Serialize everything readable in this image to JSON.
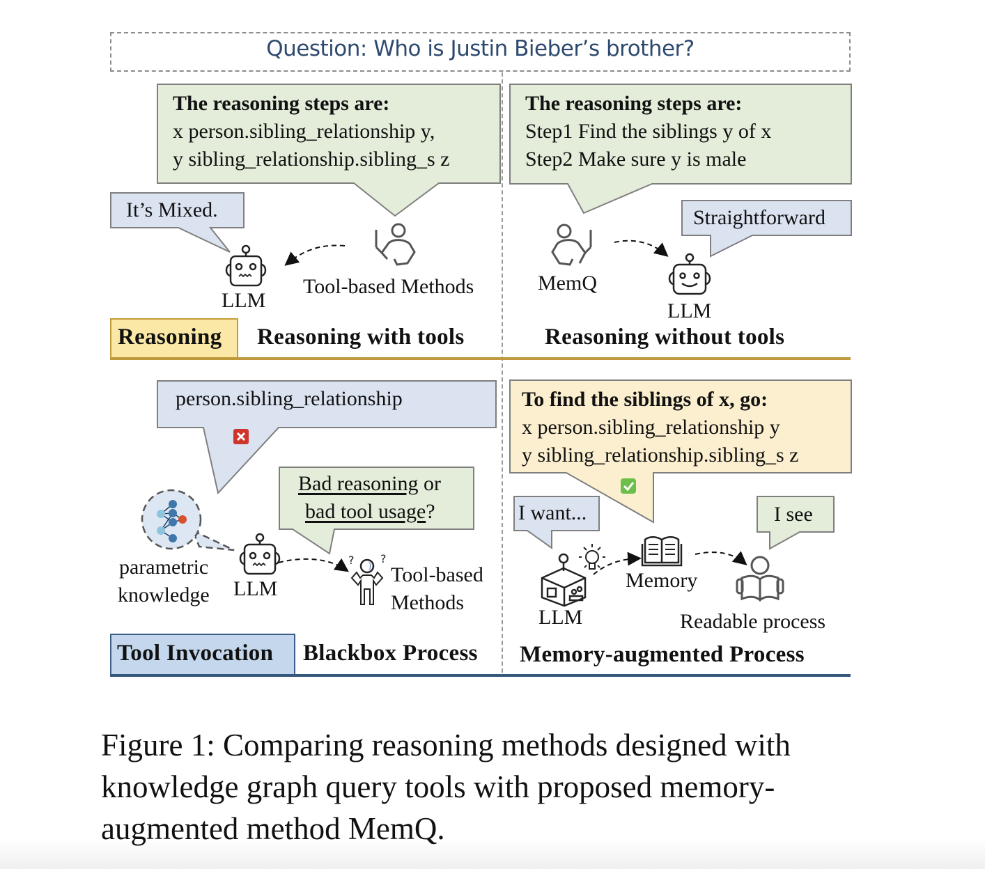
{
  "question": "Question: Who is Justin Bieber’s brother?",
  "panels": {
    "top_left": {
      "bubble_title": "The reasoning steps are:",
      "bubble_lines": [
        "x person.sibling_relationship y,",
        "y sibling_relationship.sibling_s z"
      ],
      "llm_bubble": "It’s Mixed.",
      "llm_label": "LLM",
      "tool_label": "Tool-based Methods",
      "section_title": "Reasoning with tools"
    },
    "top_right": {
      "bubble_title": "The reasoning steps are:",
      "bubble_lines": [
        "Step1 Find the siblings y of x",
        "Step2 Make sure y is male"
      ],
      "llm_bubble": "Straightforward",
      "memq_label": "MemQ",
      "llm_label": "LLM",
      "section_title": "Reasoning without tools"
    },
    "bottom_left": {
      "bubble_text": "person.sibling_relationship",
      "status_icon": "x-mark-icon",
      "question_bubble": {
        "part1": "Bad reasoning",
        "part2": " or",
        "part3": "bad tool usage",
        "part4": "?"
      },
      "param_label_1": "parametric",
      "param_label_2": "knowledge",
      "llm_label": "LLM",
      "tool_label_1": "Tool-based",
      "tool_label_2": "Methods",
      "section_title": "Blackbox Process"
    },
    "bottom_right": {
      "bubble_title": "To find the siblings of x, go:",
      "bubble_lines": [
        "x person.sibling_relationship y",
        "y sibling_relationship.sibling_s z"
      ],
      "status_icon": "check-mark-icon",
      "llm_bubble": "I want...",
      "reader_bubble": "I see",
      "llm_label": "LLM",
      "memory_label": "Memory",
      "reader_label": "Readable process",
      "section_title": "Memory-augmented Process"
    }
  },
  "row_tags": {
    "reasoning": "Reasoning",
    "tool_invocation": "Tool Invocation"
  },
  "colors": {
    "question_text": "#2d4a6e",
    "green_bubble": "#e3edd9",
    "blue_bubble": "#dbe3f1",
    "yellow_bubble": "#fbefcf",
    "reasoning_tag": "#fbe8a6",
    "reasoning_rule": "#bf9a3c",
    "tool_tag": "#c4d7ec",
    "tool_rule": "#35587e",
    "error_red": "#d0352b",
    "ok_green": "#6cbf4b"
  },
  "caption": "Figure 1: Comparing reasoning methods designed with knowledge graph query tools with proposed memory-augmented method MemQ."
}
